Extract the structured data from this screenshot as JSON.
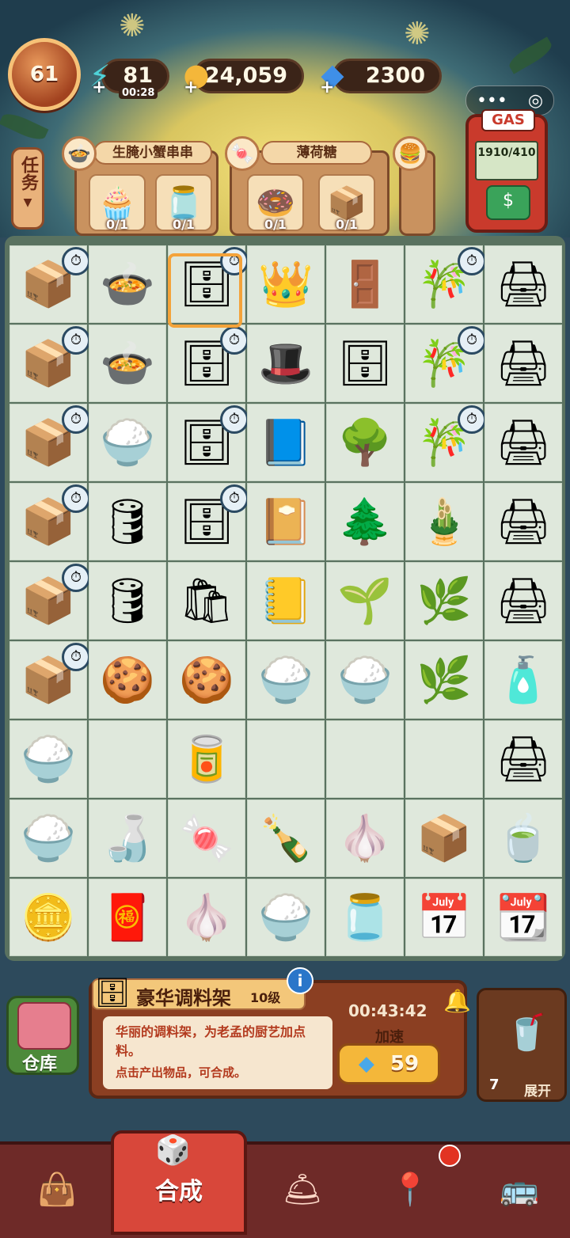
{
  "hud": {
    "level": "61",
    "energy": "81",
    "energy_timer": "00:28",
    "coins": "24,059",
    "gems": "2300"
  },
  "tasks_tab": {
    "label": "任务"
  },
  "orders": [
    {
      "title": "生腌小蟹串串",
      "slots": [
        {
          "icon": "cream-cupcake",
          "count": "0/1"
        },
        {
          "icon": "sauce-jar",
          "count": "0/1"
        }
      ]
    },
    {
      "title": "薄荷糖",
      "slots": [
        {
          "icon": "mint-candy",
          "count": "0/1"
        },
        {
          "icon": "paper-bag-box",
          "count": "0/1"
        }
      ]
    }
  ],
  "gas_pump": {
    "label": "GAS",
    "reading": "1910/410"
  },
  "board": {
    "rows": [
      [
        "drone-box|t",
        "hotpot-pot",
        "spice-rack|t",
        "chef-hat-gold",
        "locker",
        "bamboo-ribbon|t",
        "printer-big"
      ],
      [
        "drone-box|t",
        "hotpot-steam",
        "spice-shelf|t",
        "chef-hat-white",
        "cabinet-blue",
        "bamboo-ribbon|t",
        "printer-big"
      ],
      [
        "drone-box|t",
        "rice-cooker",
        "spice-shelf-small|t",
        "notebook-dino",
        "tree-big",
        "bamboo-ribbon|t",
        "printer-mid"
      ],
      [
        "drone-box|t",
        "barrel-tap",
        "spice-shelf-mini|t",
        "notebook-sun",
        "bonsai",
        "bamboo-shoot",
        "printer-small"
      ],
      [
        "drone-box|t",
        "barrel",
        "paper-bag",
        "notepad",
        "bonsai-small",
        "bamboo-leaves",
        "printer-mini"
      ],
      [
        "drone-box|t",
        "tea-plate",
        "coins-pile",
        "rice-pile",
        "rice-pile",
        "bamboo-sprout",
        "ink-bottle"
      ],
      [
        "rice-pile",
        "empty",
        "ketchup",
        "empty",
        "empty",
        "empty",
        "ink-tanks"
      ],
      [
        "rice-pile",
        "soy-bottle",
        "red-wrapper",
        "hot-sauce",
        "garlic-bag",
        "paper-box",
        "tea-leaves-plate"
      ],
      [
        "blue-coin-box",
        "red-pouch",
        "garlic-blue",
        "rice-pile",
        "chili-jar",
        "calendar-13",
        "calendar-6"
      ]
    ]
  },
  "info_panel": {
    "name": "豪华调料架",
    "level": "10级",
    "desc_line1": "华丽的调料架，为老孟的厨艺加点料。",
    "desc_line2": "点击产出物品，可合成。",
    "timer": "00:43:42",
    "speedup_label": "加速",
    "speedup_cost": "59"
  },
  "warehouse": {
    "label": "仓库"
  },
  "expand": {
    "count": "7",
    "label": "展开"
  },
  "bottom_nav": {
    "items": [
      {
        "name": "nav-shop",
        "icon": "cat-bag-icon"
      },
      {
        "name": "nav-merge",
        "icon": "dice-cards-icon",
        "label": "合成"
      },
      {
        "name": "nav-service",
        "icon": "service-bell-icon"
      },
      {
        "name": "nav-map",
        "icon": "map-pin-icon"
      },
      {
        "name": "nav-bus",
        "icon": "bus-icon"
      }
    ]
  },
  "colors": {
    "board_bg": "#dfe8dc",
    "panel_brown": "#8b3f22",
    "accent_orange": "#f4b73a",
    "nav_red": "#d8473a"
  }
}
